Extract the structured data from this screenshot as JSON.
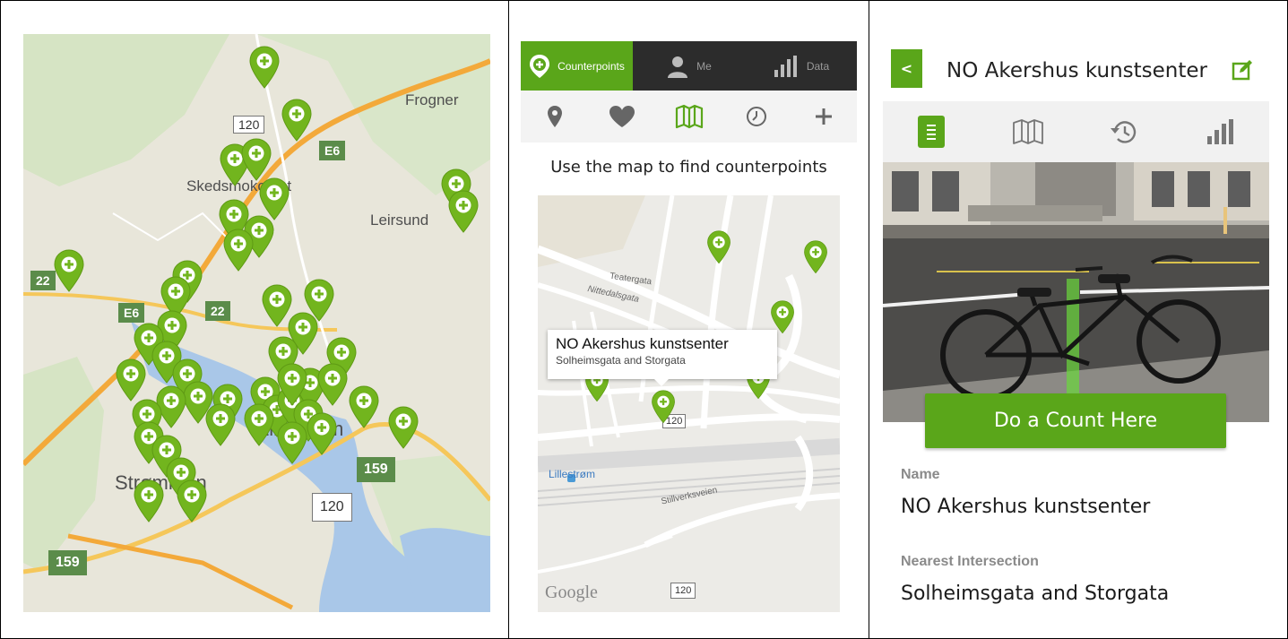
{
  "overview_map": {
    "places": [
      "Frogner",
      "Skedsmokorset",
      "Leirsund",
      "Lillestrøm",
      "Strømmen"
    ],
    "road_shields_white": [
      "120",
      "120"
    ],
    "road_shields_green": [
      "E6",
      "E6",
      "22",
      "22",
      "159",
      "159"
    ]
  },
  "app_map_screen": {
    "tabs": [
      {
        "label": "Counterpoints",
        "icon": "location-plus-icon",
        "active": true
      },
      {
        "label": "Me",
        "icon": "person-icon",
        "active": false
      },
      {
        "label": "Data",
        "icon": "bar-chart-icon",
        "active": false
      }
    ],
    "subnav": [
      "pin-icon",
      "heart-icon",
      "map-icon",
      "clock-icon",
      "plus-icon"
    ],
    "instruction": "Use the map to find counterpoints",
    "streets": [
      "Teatergata",
      "Nittedalsgata",
      "Stillverksveien",
      "Lillestrøm"
    ],
    "callout": {
      "title": "NO Akershus kunstsenter",
      "subtitle": "Solheimsgata and Storgata"
    },
    "shields": [
      "120",
      "120"
    ],
    "map_attribution": "Google"
  },
  "detail_screen": {
    "back_label": "<",
    "title": "NO Akershus kunstsenter",
    "icons": [
      "list-icon",
      "map-icon",
      "history-icon",
      "bar-chart-icon"
    ],
    "count_button": "Do a Count Here",
    "fields": [
      {
        "label": "Name",
        "value": "NO Akershus kunstsenter"
      },
      {
        "label": "Nearest Intersection",
        "value": "Solheimsgata and Storgata"
      }
    ]
  },
  "colors": {
    "accent": "#5aa61a",
    "pin": "#72b51e",
    "tab_bg": "#2c2c2c"
  }
}
